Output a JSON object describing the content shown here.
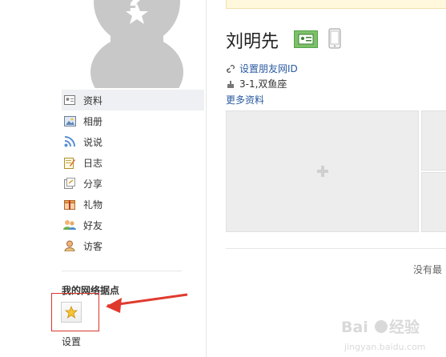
{
  "profile": {
    "name": "刘明先",
    "set_id_link": "设置朋友网ID",
    "constellation": "3-1,双鱼座",
    "more_info": "更多资料"
  },
  "sidebar": {
    "items": [
      {
        "label": "资料",
        "icon": "profile-card-icon",
        "active": true
      },
      {
        "label": "相册",
        "icon": "photo-album-icon"
      },
      {
        "label": "说说",
        "icon": "rss-icon"
      },
      {
        "label": "日志",
        "icon": "notepad-icon"
      },
      {
        "label": "分享",
        "icon": "share-icon"
      },
      {
        "label": "礼物",
        "icon": "gift-icon"
      },
      {
        "label": "好友",
        "icon": "friends-icon"
      },
      {
        "label": "访客",
        "icon": "visitor-icon"
      }
    ],
    "section_title": "我的网络据点",
    "settings_label": "设置"
  },
  "main": {
    "empty_text": "没有最"
  },
  "watermark": {
    "text": "Baidu经验",
    "url_text": "jingyan.baidu.com"
  },
  "colors": {
    "link": "#2a5aa0",
    "highlight_box": "#d9372b",
    "notice_bg": "#fff8dc",
    "placeholder_gray": "#ededed"
  }
}
